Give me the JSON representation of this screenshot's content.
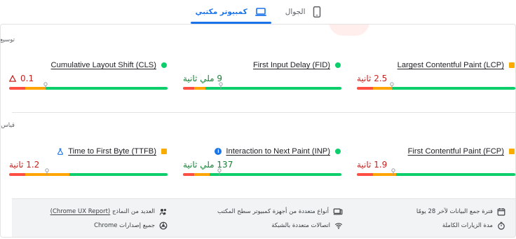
{
  "tabs": [
    {
      "label": "الجوال",
      "icon": "phone-icon",
      "active": false
    },
    {
      "label": "كمبيوتر مكتبي",
      "icon": "laptop-icon",
      "active": true
    }
  ],
  "sections": [
    {
      "title": "توسيع العرض",
      "metrics": [
        {
          "name": "Largest Contentful Paint (LCP)",
          "status": "needs-improvement",
          "status_icon": "orange-square-icon",
          "value": "2.5 ثانية",
          "value_type": "warn",
          "distribution": {
            "poor": 0.1,
            "needs_improvement": 0.12,
            "good": 0.78
          },
          "marker": 0.22
        },
        {
          "name": "First Input Delay (FID)",
          "status": "good",
          "status_icon": "green-dot-icon",
          "value": "9 ملي ثانية",
          "value_type": "good",
          "distribution": {
            "poor": 0.07,
            "needs_improvement": 0.07,
            "good": 0.86
          },
          "marker": 0.24
        },
        {
          "name": "Cumulative Layout Shift (CLS)",
          "status": "good",
          "status_icon": "green-dot-icon",
          "value": "0.1",
          "value_type": "warn",
          "value_icon": "warning-triangle-icon",
          "distribution": {
            "poor": 0.1,
            "needs_improvement": 0.13,
            "good": 0.77
          },
          "marker": 0.23
        }
      ]
    },
    {
      "title": "قياس مهمة أخرى",
      "metrics": [
        {
          "name": "First Contentful Paint (FCP)",
          "status": "needs-improvement",
          "status_icon": "orange-square-icon",
          "value": "1.9 ثانية",
          "value_type": "warn",
          "distribution": {
            "poor": 0.1,
            "needs_improvement": 0.15,
            "good": 0.75
          },
          "marker": 0.23
        },
        {
          "name": "Interaction to Next Paint (INP)",
          "status": "good",
          "status_icon": "info-icon",
          "value": "137 ملي ثانية",
          "value_type": "good",
          "distribution": {
            "poor": 0.07,
            "needs_improvement": 0.1,
            "good": 0.83
          },
          "marker": 0.23
        },
        {
          "name": "Time to First Byte (TTFB)",
          "status": "needs-improvement",
          "status_icon": "orange-square-icon",
          "value": "1.2 ثانية",
          "value_type": "warn",
          "name_icon": "flask-icon",
          "distribution": {
            "poor": 0.1,
            "needs_improvement": 0.28,
            "good": 0.62
          },
          "marker": 0.24
        }
      ]
    }
  ],
  "footer": {
    "items": [
      {
        "icon": "calendar-icon",
        "text": "فترة جمع البيانات لآخر 28 يومًا"
      },
      {
        "icon": "devices-icon",
        "text": "أنواع متعددة من أجهزة كمبيوتر سطح المكتب"
      },
      {
        "icon": "users-icon",
        "text_prefix": "العديد من النماذج",
        "link_text": "(Chrome UX Report)"
      },
      {
        "icon": "timer-icon",
        "text": "مدة الزيارات الكاملة"
      },
      {
        "icon": "wifi-icon",
        "text": "اتصالات متعددة بالشبكة"
      },
      {
        "icon": "chrome-icon",
        "text": "جميع إصدارات Chrome"
      }
    ]
  },
  "colors": {
    "accent": "#1a73e8",
    "good": "#0cce6b",
    "needs_improvement": "#ffa400",
    "poor": "#ff4e42"
  }
}
